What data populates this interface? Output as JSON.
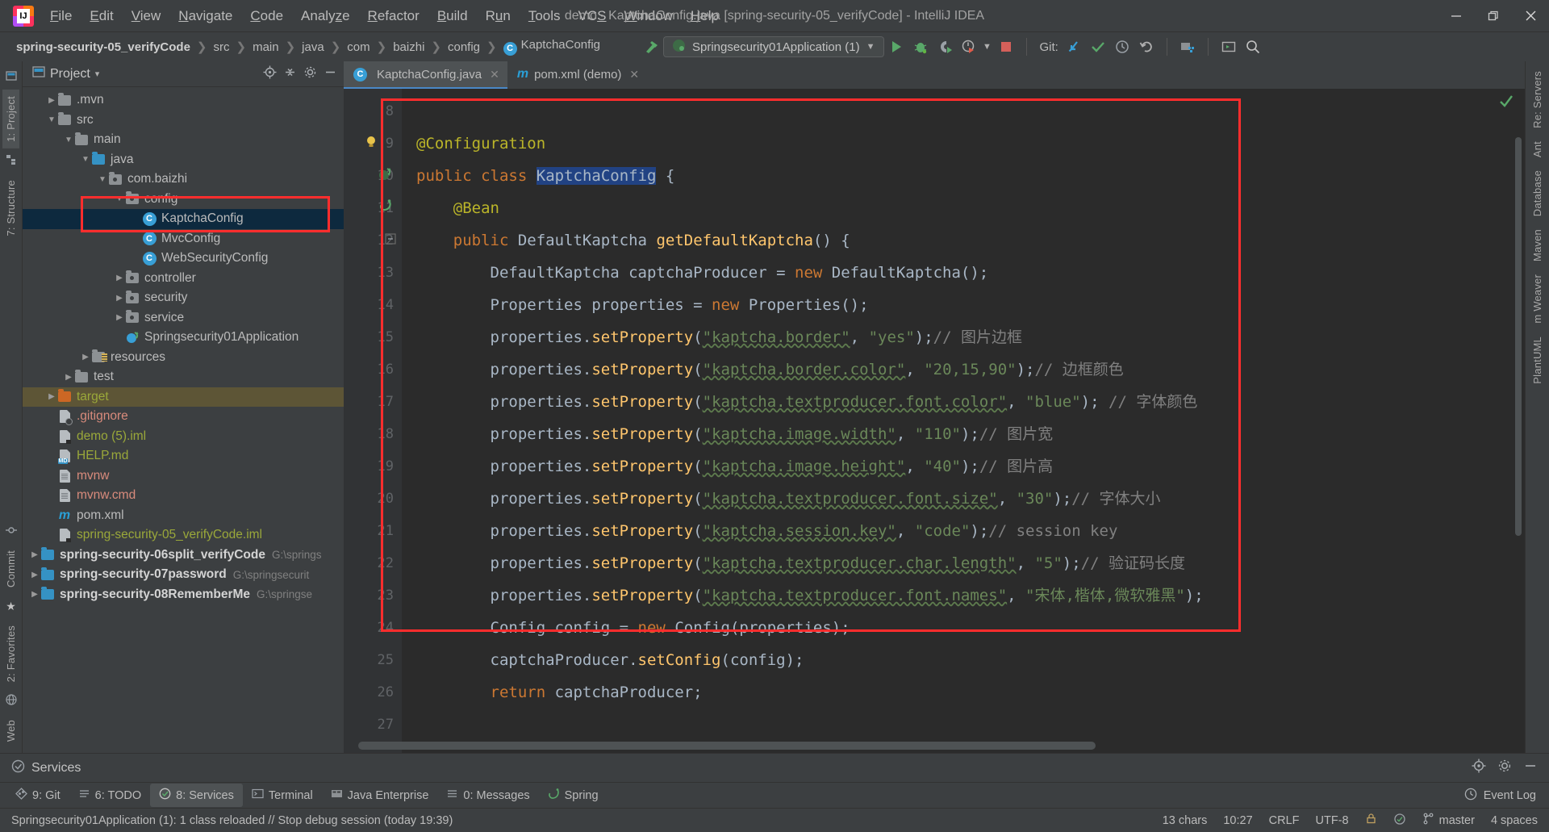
{
  "window": {
    "title": "demo - KaptchaConfig.java [spring-security-05_verifyCode] - IntelliJ IDEA",
    "minimize": "—",
    "maximize": "❐",
    "close": "✕"
  },
  "menu": [
    {
      "label": "File"
    },
    {
      "label": "Edit"
    },
    {
      "label": "View"
    },
    {
      "label": "Navigate"
    },
    {
      "label": "Code"
    },
    {
      "label": "Analyze"
    },
    {
      "label": "Refactor"
    },
    {
      "label": "Build"
    },
    {
      "label": "Run"
    },
    {
      "label": "Tools"
    },
    {
      "label": "VCS"
    },
    {
      "label": "Window"
    },
    {
      "label": "Help"
    }
  ],
  "breadcrumbs": [
    {
      "label": "spring-security-05_verifyCode",
      "bold": true
    },
    {
      "label": "src"
    },
    {
      "label": "main"
    },
    {
      "label": "java"
    },
    {
      "label": "com"
    },
    {
      "label": "baizhi"
    },
    {
      "label": "config"
    },
    {
      "label": "KaptchaConfig",
      "icon": "class-icon"
    }
  ],
  "toolbar": {
    "build_icon": "hammer-icon",
    "run_config": "Springsecurity01Application (1)",
    "run_icon": "run-icon",
    "debug_icon": "debug-icon",
    "run_coverage_icon": "run-with-coverage-icon",
    "profiler_icon": "profiler-icon",
    "stop_icon": "stop-icon",
    "git_label": "Git:",
    "git_update_icon": "update-project-icon",
    "git_commit_icon": "commit-icon",
    "git_history_icon": "history-icon",
    "git_rollback_icon": "rollback-icon",
    "project_structure_icon": "project-structure-icon",
    "terminal_icon": "terminal-icon",
    "search_icon": "search-everywhere-icon"
  },
  "left_rail": {
    "top": [
      "1: Project",
      "7: Structure"
    ],
    "bottom": [
      "2: Favorites",
      "Web"
    ]
  },
  "right_rail": {
    "items": [
      "Re: Servers",
      "Ant",
      "Database",
      "Maven",
      "m Weaver",
      "PlantUML"
    ]
  },
  "project_panel": {
    "title": "Project",
    "chevron": "▾",
    "icons": [
      "locate-icon",
      "collapse-all-icon",
      "settings-icon",
      "hide-icon"
    ],
    "tree": [
      {
        "depth": 1,
        "arrow": "▶",
        "icon": "folder",
        "label": ".mvn"
      },
      {
        "depth": 1,
        "arrow": "▼",
        "icon": "folder",
        "label": "src"
      },
      {
        "depth": 2,
        "arrow": "▼",
        "icon": "folder",
        "label": "main"
      },
      {
        "depth": 3,
        "arrow": "▼",
        "icon": "folder-source",
        "label": "java"
      },
      {
        "depth": 4,
        "arrow": "▼",
        "icon": "folder-package",
        "label": "com.baizhi"
      },
      {
        "depth": 5,
        "arrow": "▼",
        "icon": "folder-package",
        "label": "config"
      },
      {
        "depth": 6,
        "arrow": "",
        "icon": "class-icon",
        "label": "KaptchaConfig",
        "selected": true
      },
      {
        "depth": 6,
        "arrow": "",
        "icon": "class-icon",
        "label": "MvcConfig"
      },
      {
        "depth": 6,
        "arrow": "",
        "icon": "class-icon",
        "label": "WebSecurityConfig"
      },
      {
        "depth": 5,
        "arrow": "▶",
        "icon": "folder-package",
        "label": "controller"
      },
      {
        "depth": 5,
        "arrow": "▶",
        "icon": "folder-package",
        "label": "security"
      },
      {
        "depth": 5,
        "arrow": "▶",
        "icon": "folder-package",
        "label": "service"
      },
      {
        "depth": 5,
        "arrow": "",
        "icon": "spring-class-icon",
        "label": "Springsecurity01Application"
      },
      {
        "depth": 3,
        "arrow": "▶",
        "icon": "folder-resources",
        "label": "resources"
      },
      {
        "depth": 2,
        "arrow": "▶",
        "icon": "folder",
        "label": "test"
      },
      {
        "depth": 1,
        "arrow": "▶",
        "icon": "folder-excluded",
        "label": "target",
        "highlight": true,
        "color": "#9aa83a"
      },
      {
        "depth": 1,
        "arrow": "",
        "icon": "file-ignored",
        "label": ".gitignore",
        "color": "#d98b7c"
      },
      {
        "depth": 1,
        "arrow": "",
        "icon": "file-iml",
        "label": "demo (5).iml",
        "color": "#9aa83a"
      },
      {
        "depth": 1,
        "arrow": "",
        "icon": "file-md",
        "label": "HELP.md",
        "color": "#9aa83a"
      },
      {
        "depth": 1,
        "arrow": "",
        "icon": "file-text",
        "label": "mvnw",
        "color": "#d98b7c"
      },
      {
        "depth": 1,
        "arrow": "",
        "icon": "file-text",
        "label": "mvnw.cmd",
        "color": "#d98b7c"
      },
      {
        "depth": 1,
        "arrow": "",
        "icon": "maven-icon",
        "label": "pom.xml"
      },
      {
        "depth": 1,
        "arrow": "",
        "icon": "file-iml",
        "label": "spring-security-05_verifyCode.iml",
        "color": "#9aa83a"
      },
      {
        "depth": 0,
        "arrow": "▶",
        "icon": "module-icon",
        "label": "spring-security-06split_verifyCode",
        "bold": true,
        "path": "G:\\springs"
      },
      {
        "depth": 0,
        "arrow": "▶",
        "icon": "module-icon",
        "label": "spring-security-07password",
        "bold": true,
        "path": "G:\\springsecurit"
      },
      {
        "depth": 0,
        "arrow": "▶",
        "icon": "module-icon",
        "label": "spring-security-08RememberMe",
        "bold": true,
        "path": "G:\\springse"
      }
    ]
  },
  "editor": {
    "tabs": [
      {
        "label": "KaptchaConfig.java",
        "icon": "class-icon",
        "active": true,
        "close": "✕"
      },
      {
        "label": "pom.xml (demo)",
        "icon": "maven-icon",
        "active": false,
        "close": "✕"
      }
    ],
    "first_line": 8,
    "lines": [
      {
        "n": 8,
        "text": ""
      },
      {
        "n": 9,
        "text": "@Configuration"
      },
      {
        "n": 10,
        "text": "public class KaptchaConfig {"
      },
      {
        "n": 11,
        "text": "    @Bean"
      },
      {
        "n": 12,
        "text": "    public DefaultKaptcha getDefaultKaptcha() {"
      },
      {
        "n": 13,
        "text": "        DefaultKaptcha captchaProducer = new DefaultKaptcha();"
      },
      {
        "n": 14,
        "text": "        Properties properties = new Properties();"
      },
      {
        "n": 15,
        "text": "        properties.setProperty(\"kaptcha.border\", \"yes\");// 图片边框"
      },
      {
        "n": 16,
        "text": "        properties.setProperty(\"kaptcha.border.color\", \"20,15,90\");// 边框颜色"
      },
      {
        "n": 17,
        "text": "        properties.setProperty(\"kaptcha.textproducer.font.color\", \"blue\"); // 字体颜色"
      },
      {
        "n": 18,
        "text": "        properties.setProperty(\"kaptcha.image.width\", \"110\");// 图片宽"
      },
      {
        "n": 19,
        "text": "        properties.setProperty(\"kaptcha.image.height\", \"40\");// 图片高"
      },
      {
        "n": 20,
        "text": "        properties.setProperty(\"kaptcha.textproducer.font.size\", \"30\");// 字体大小"
      },
      {
        "n": 21,
        "text": "        properties.setProperty(\"kaptcha.session.key\", \"code\");// session key"
      },
      {
        "n": 22,
        "text": "        properties.setProperty(\"kaptcha.textproducer.char.length\", \"5\");// 验证码长度"
      },
      {
        "n": 23,
        "text": "        properties.setProperty(\"kaptcha.textproducer.font.names\", \"宋体,楷体,微软雅黑\");"
      },
      {
        "n": 24,
        "text": "        Config config = new Config(properties);"
      },
      {
        "n": 25,
        "text": "        captchaProducer.setConfig(config);"
      },
      {
        "n": 26,
        "text": "        return captchaProducer;"
      },
      {
        "n": 27,
        "text": ""
      }
    ],
    "selected_token": "KaptchaConfig",
    "inspection_status": "ok"
  },
  "services_panel": {
    "title": "Services",
    "icons": [
      "locate-icon",
      "settings-icon",
      "hide-icon"
    ]
  },
  "tool_windows": [
    {
      "label": "9: Git",
      "icon": "git-icon",
      "active": false
    },
    {
      "label": "6: TODO",
      "icon": "todo-icon",
      "active": false
    },
    {
      "label": "8: Services",
      "icon": "services-icon",
      "active": true
    },
    {
      "label": "Terminal",
      "icon": "terminal-icon",
      "active": false
    },
    {
      "label": "Java Enterprise",
      "icon": "java-enterprise-icon",
      "active": false
    },
    {
      "label": "0: Messages",
      "icon": "messages-icon",
      "active": false
    },
    {
      "label": "Spring",
      "icon": "spring-icon",
      "active": false
    }
  ],
  "event_log": {
    "label": "Event Log",
    "icon": "event-log-icon"
  },
  "statusbar": {
    "message": "Springsecurity01Application (1): 1 class reloaded // Stop debug session (today 19:39)",
    "chars": "13 chars",
    "caret": "10:27",
    "line_sep": "CRLF",
    "encoding": "UTF-8",
    "lock_icon": "lock-icon",
    "inspection_icon": "inspection-icon",
    "branch_icon": "branch-icon",
    "branch": "master",
    "indent": "4 spaces"
  },
  "colors": {
    "accent_blue": "#4a88c7",
    "class_badge": "#389fd6",
    "selection_bg": "#0d293e",
    "annotation_red": "#ff2d2d",
    "keyword": "#cc7832",
    "string": "#6a8759",
    "method": "#ffc66d",
    "number": "#6897bb",
    "comment": "#808080",
    "annotation": "#bbb529",
    "editor_bg": "#2b2b2b",
    "ui_bg": "#3c3f41"
  }
}
